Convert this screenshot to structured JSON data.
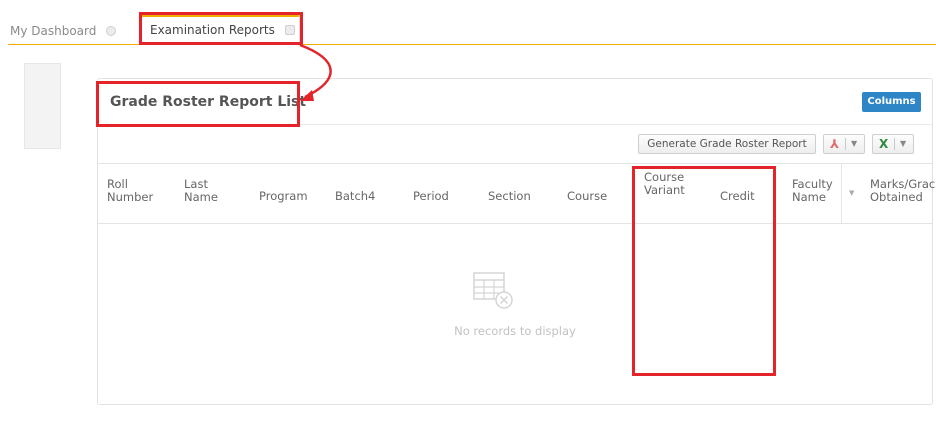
{
  "tabs": [
    {
      "label": "My Dashboard"
    },
    {
      "label": "Examination Reports"
    }
  ],
  "card": {
    "title": "Grade Roster Report List",
    "columns_button": "Columns"
  },
  "toolbar": {
    "generate_label": "Generate Grade Roster Report",
    "pdf_icon": "pdf-icon",
    "excel_icon": "excel-icon"
  },
  "table": {
    "headers": [
      {
        "line1": "Roll",
        "line2": "Number"
      },
      {
        "line1": "Last",
        "line2": "Name"
      },
      {
        "line1": "Program",
        "line2": ""
      },
      {
        "line1": "Batch4",
        "line2": ""
      },
      {
        "line1": "Period",
        "line2": ""
      },
      {
        "line1": "Section",
        "line2": ""
      },
      {
        "line1": "Course",
        "line2": ""
      },
      {
        "line1": "Course",
        "line2": "Variant"
      },
      {
        "line1": "Credit",
        "line2": ""
      },
      {
        "line1": "Faculty",
        "line2": "Name"
      },
      {
        "line1": "Marks/Grac",
        "line2": "Obtained"
      }
    ],
    "empty_text": "No records to display"
  },
  "colors": {
    "accent": "#f0ad00",
    "annotation": "#e3242b",
    "primary_button": "#2f86c6"
  }
}
